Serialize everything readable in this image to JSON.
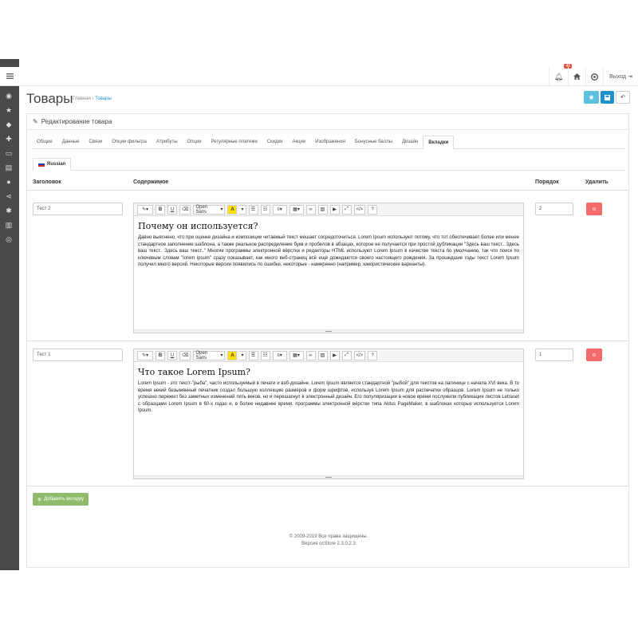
{
  "header": {
    "notifications_count": "49",
    "logout_label": "Выход"
  },
  "page": {
    "title": "Товары",
    "breadcrumb": [
      "Главная",
      "Товары"
    ]
  },
  "panel": {
    "heading": "Редактирование товара"
  },
  "tabs": [
    "Общие",
    "Данные",
    "Связи",
    "Опции фильтра",
    "Атрибуты",
    "Опции",
    "Регулярные платежи",
    "Скидки",
    "Акции",
    "Изображения",
    "Бонусные баллы",
    "Дизайн",
    "Вкладки"
  ],
  "active_tab": "Вкладки",
  "language_tab": "Russian",
  "columns": {
    "title": "Заголовок",
    "content": "Содержимое",
    "order": "Порядок",
    "delete": "Удалить"
  },
  "editor_toolbar": {
    "font": "Open Sans"
  },
  "rows": [
    {
      "title_value": "Тест 2",
      "heading": "Почему он используется?",
      "body": "Давно выяснено, что при оценке дизайна и композиции читаемый текст мешает сосредоточиться. Lorem Ipsum используют потому, что тот обеспечивает более или менее стандартное заполнение шаблона, а также реальное распределение букв и пробелов в абзацах, которое не получается при простой дубликации \"Здесь ваш текст.. Здесь ваш текст.. Здесь ваш текст..\" Многие программы электронной вёрстки и редакторы HTML используют Lorem Ipsum в качестве текста по умолчанию, так что поиск по ключевым словам \"lorem ipsum\" сразу показывает, как много веб-страниц всё ещё дожидаются своего настоящего рождения. За прошедшие годы текст Lorem Ipsum получил много версий. Некоторые версии появились по ошибке, некоторые - намеренно (например, юмористические варианты).",
      "order": "2"
    },
    {
      "title_value": "Тест 1",
      "heading": "Что такое Lorem Ipsum?",
      "body": "Lorem Ipsum - это текст-\"рыба\", часто используемый в печати и вэб-дизайне. Lorem Ipsum является стандартной \"рыбой\" для текстов на латинице с начала XVI века. В то время некий безымянный печатник создал большую коллекцию размеров и форм шрифтов, используя Lorem Ipsum для распечатки образцов. Lorem Ipsum не только успешно пережил без заметных изменений пять веков, но и перешагнул в электронный дизайн. Его популяризации в новое время послужили публикация листов Letraset с образцами Lorem Ipsum в 60-х годах и, в более недавнее время, программы электронной вёрстки типа Aldus PageMaker, в шаблонах которых используется Lorem Ipsum.",
      "order": "1"
    }
  ],
  "add_button": "Добавить вкладку",
  "footer": {
    "copyright": "© 2009-2019 Все права защищены.",
    "version": "Версия ocStore 2.3.0.2.3"
  },
  "colors": {
    "sidebar": "#4a4a4a",
    "primary": "#1e91cf",
    "info": "#5bc0de",
    "danger": "#f56b6b",
    "success": "#8fbb6c"
  }
}
